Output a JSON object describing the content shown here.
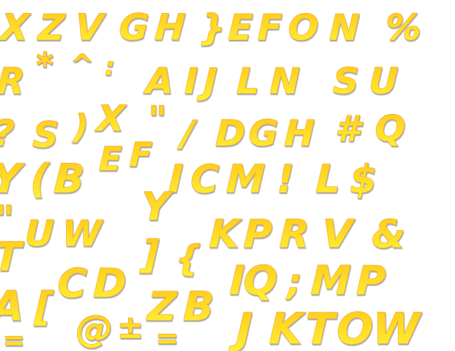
{
  "sheet": {
    "gradient_top": "#ffc71a",
    "gradient_bottom": "#fff236",
    "outline": "#e49a2a",
    "shadow": "#8d8d8d",
    "background": "#ffffff"
  },
  "glyphs": [
    "X",
    "Z",
    "V",
    "G",
    "H",
    "}",
    "E",
    "F",
    "O",
    "N",
    "%",
    "R",
    "*",
    "^",
    ":",
    "A",
    "I",
    "J",
    "L",
    "N",
    "S",
    "U",
    "?",
    "S",
    ")",
    "X",
    "\"",
    "/",
    "D",
    "G",
    "H",
    "#",
    "Q",
    "Y",
    "(",
    "B",
    "E",
    "F",
    "I",
    "C",
    "M",
    "!",
    "L",
    "$",
    "\"",
    "U",
    "W",
    "Y",
    "K",
    "P",
    "R",
    "V",
    "&",
    "T",
    "]",
    "{",
    "C",
    "D",
    "I",
    "Q",
    ";",
    "M",
    "P",
    "A",
    "[",
    "Z",
    "B",
    "=",
    "@",
    "±",
    "=",
    "J",
    "K",
    "T",
    "O",
    "W"
  ]
}
